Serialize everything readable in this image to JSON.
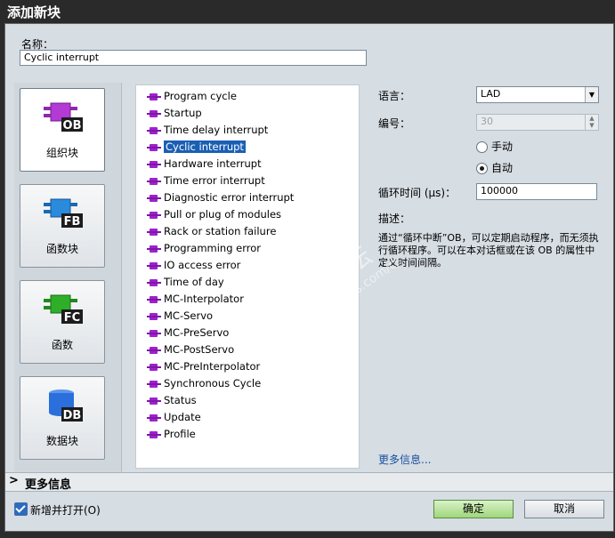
{
  "window": {
    "title": "添加新块"
  },
  "name_field": {
    "label": "名称：",
    "value": "Cyclic interrupt"
  },
  "block_types": [
    {
      "code": "OB",
      "label": "组织块",
      "color": "#b43ad6",
      "selected": true
    },
    {
      "code": "FB",
      "label": "函数块",
      "color": "#2a8bdc",
      "selected": false
    },
    {
      "code": "FC",
      "label": "函数",
      "color": "#2fae2a",
      "selected": false
    },
    {
      "code": "DB",
      "label": "数据块",
      "color": "#2a6fdc",
      "selected": false
    }
  ],
  "ob_list": [
    "Program cycle",
    "Startup",
    "Time delay interrupt",
    "Cyclic interrupt",
    "Hardware interrupt",
    "Time error interrupt",
    "Diagnostic error interrupt",
    "Pull or plug of modules",
    "Rack or station failure",
    "Programming error",
    "IO access error",
    "Time of day",
    "MC-Interpolator",
    "MC-Servo",
    "MC-PreServo",
    "MC-PostServo",
    "MC-PreInterpolator",
    "Synchronous Cycle",
    "Status",
    "Update",
    "Profile"
  ],
  "selected_ob_index": 3,
  "properties": {
    "language_label": "语言：",
    "language_value": "LAD",
    "number_label": "编号：",
    "number_value": "30",
    "manual_label": "手动",
    "auto_label": "自动",
    "auto_selected": true,
    "cycle_label": "循环时间 (μs)：",
    "cycle_value": "100000",
    "desc_label": "描述：",
    "description": "通过“循环中断”OB，可以定期启动程序，而无须执行循环程序。可以在本对话框或在该 OB 的属性中定义时间间隔。",
    "more_link": "更多信息..."
  },
  "more_info_bar": {
    "chevron": ">",
    "label": "更多信息"
  },
  "footer": {
    "checkbox_label": "新增并打开(O)",
    "checked": true,
    "ok_label": "确定",
    "cancel_label": "取消"
  },
  "watermark": {
    "line1": "工业 技术论坛",
    "line2": "bbs.industry.siemens.com/cs"
  }
}
